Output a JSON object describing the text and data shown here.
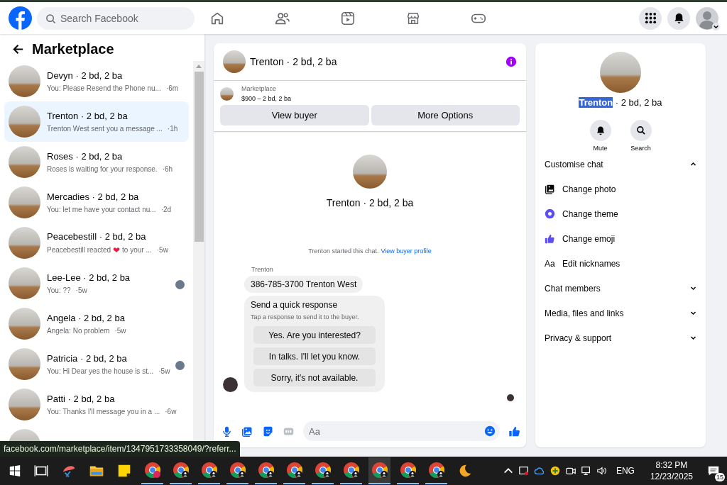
{
  "header": {
    "search": {
      "placeholder": "Search Facebook"
    }
  },
  "sidebar": {
    "title": "Marketplace",
    "conversations": [
      {
        "name": "Devyn · 2 bd, 2 ba",
        "preview": "You: Please Resend the Phone nu...",
        "time": "·6m",
        "selected": false,
        "seen": false
      },
      {
        "name": "Trenton · 2 bd, 2 ba",
        "preview": "Trenton West sent you a message ...",
        "time": "·1h",
        "selected": true,
        "seen": false
      },
      {
        "name": "Roses · 2 bd, 2 ba",
        "preview": "Roses is waiting for your response.",
        "time": "·6h",
        "selected": false,
        "seen": false
      },
      {
        "name": "Mercadies · 2 bd, 2 ba",
        "preview": "You: let me have your contact nu...",
        "time": "·2d",
        "selected": false,
        "seen": false
      },
      {
        "name": "Peacebestill · 2 bd, 2 ba",
        "preview": "Peacebestill reacted",
        "reaction": "❤",
        "preview_end": "to your ...",
        "time": "·5w",
        "selected": false,
        "seen": false
      },
      {
        "name": "Lee-Lee · 2 bd, 2 ba",
        "preview": "You: ??",
        "time": "·5w",
        "selected": false,
        "seen": true
      },
      {
        "name": "Angela · 2 bd, 2 ba",
        "preview": "Angela: No problem",
        "time": "·5w",
        "selected": false,
        "seen": false
      },
      {
        "name": "Patricia · 2 bd, 2 ba",
        "preview": "You: Hi Dear yes the house is st...",
        "time": "·5w",
        "selected": false,
        "seen": true
      },
      {
        "name": "Patti · 2 bd, 2 ba",
        "preview": "You: Thanks I'll message you in a ...",
        "time": "·6w",
        "selected": false,
        "seen": false
      }
    ]
  },
  "chat": {
    "title": "Trenton · 2 bd, 2 ba",
    "listing": {
      "label": "Marketplace",
      "price": "$900 – 2 bd, 2 ba"
    },
    "buttons": [
      "View buyer",
      "More Options"
    ],
    "intro": {
      "title": "Trenton · 2 bd, 2 ba",
      "note": "Trenton started this chat.",
      "link": "View buyer profile"
    },
    "sender": "Trenton",
    "message": "386-785-3700 Trenton West",
    "quick_response": {
      "title": "Send a quick response",
      "hint": "Tap a response to send it to the buyer.",
      "options": [
        "Yes. Are you interested?",
        "In talks. I'll let you know.",
        "Sorry, it's not available."
      ]
    },
    "composer": {
      "placeholder": "Aa"
    }
  },
  "details": {
    "title": [
      {
        "text": "Trenton",
        "selected": true
      },
      {
        "text": " · 2 bd, 2 ba",
        "selected": false
      }
    ],
    "actions": [
      {
        "kind": "mute",
        "label": "Mute"
      },
      {
        "kind": "search",
        "label": "Search"
      }
    ],
    "sections": [
      {
        "title": "Customise chat",
        "expanded": true,
        "items": [
          {
            "kind": "photo",
            "label": "Change photo"
          },
          {
            "kind": "theme",
            "label": "Change theme"
          },
          {
            "kind": "emoji",
            "label": "Change emoji"
          },
          {
            "kind": "nicknames",
            "icon_text": "Aa",
            "label": "Edit nicknames"
          }
        ]
      },
      {
        "title": "Chat members",
        "expanded": false
      },
      {
        "title": "Media, files and links",
        "expanded": false
      },
      {
        "title": "Privacy & support",
        "expanded": false
      }
    ]
  },
  "status_url": "facebook.com/marketplace/item/1347951733358049/?referr...",
  "taskbar": {
    "language": "ENG",
    "time": "8:32 PM",
    "date": "12/23/2025",
    "notifications": "15"
  }
}
